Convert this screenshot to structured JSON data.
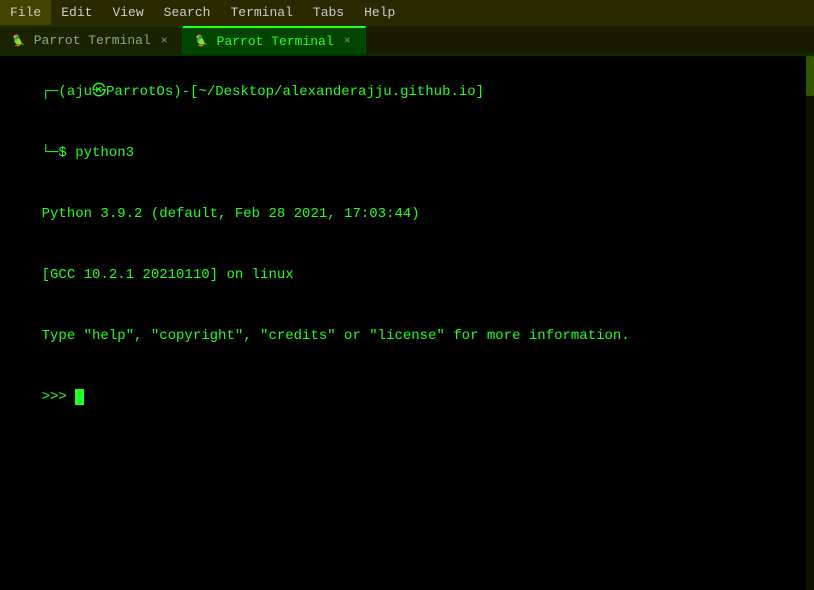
{
  "menubar": {
    "items": [
      "File",
      "Edit",
      "View",
      "Search",
      "Terminal",
      "Tabs",
      "Help"
    ]
  },
  "tabbar": {
    "tab1": {
      "label": "Parrot Terminal",
      "active": false,
      "close": "×"
    },
    "tab2": {
      "label": "Parrot Terminal",
      "active": true,
      "close": "×"
    }
  },
  "terminal": {
    "prompt_prefix": "┌─(aju㉿ParrotOs)-[~/Desktop/alexanderajju.github.io]",
    "prompt_command": "└─$ python3",
    "line1": "Python 3.9.2 (default, Feb 28 2021, 17:03:44)",
    "line2": "[GCC 10.2.1 20210110] on linux",
    "line3": "Type \"help\", \"copyright\", \"credits\" or \"license\" for more information.",
    "repl_prompt": ">>> "
  }
}
